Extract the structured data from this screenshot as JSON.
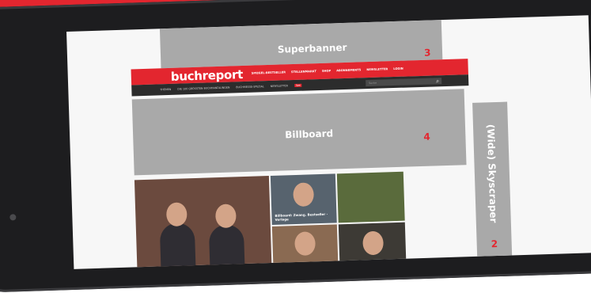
{
  "colors": {
    "accent": "#e3262f",
    "ad_placeholder": "#a9a9a9",
    "dark_nav": "#2c2c2c"
  },
  "ads": {
    "superbanner": {
      "label": "Superbanner",
      "number": "3"
    },
    "billboard": {
      "label": "Billboard",
      "number": "4"
    },
    "skyscraper": {
      "label": "(Wide) Skyscraper",
      "number": "2"
    }
  },
  "site": {
    "logo": "buchreport",
    "nav": [
      "SPIEGEL-BESTSELLER",
      "STELLENMARKT",
      "SHOP",
      "ABONNEMENTS",
      "NEWSLETTER",
      "LOGIN"
    ],
    "subnav": [
      "THEMEN",
      "DIE 100 GRÖSSTEN BUCHHANDLUNGEN",
      "BUCHMESSE-SPEZIAL",
      "NEWSLETTER"
    ],
    "live_badge": "live",
    "search_placeholder": "Suche"
  },
  "photos": {
    "photo2_caption": "Billboard: Zwang. Bestseller · Verlage"
  }
}
